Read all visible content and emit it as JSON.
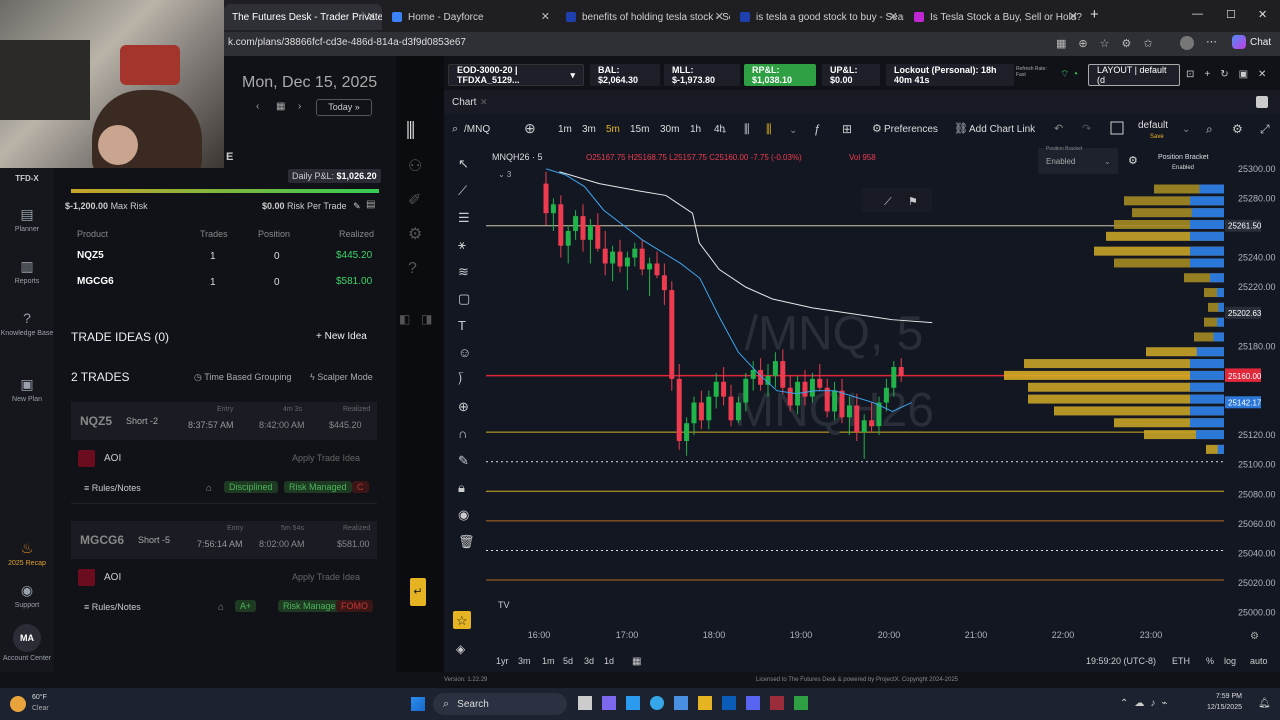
{
  "browser": {
    "tabs": [
      {
        "label": "The Futures Desk - Trader Private",
        "active": true,
        "color": "#2a6bd1"
      },
      {
        "label": "Home - Dayforce",
        "active": false,
        "color": "#3b82f6"
      },
      {
        "label": "benefits of holding tesla stock - Se",
        "active": false,
        "color": "#3b82f6"
      },
      {
        "label": "is tesla a good stock to buy - Sear",
        "active": false,
        "color": "#3b82f6"
      },
      {
        "label": "Is Tesla Stock a Buy, Sell or Hold?",
        "active": false,
        "color": "#c026d3"
      }
    ],
    "url": "k.com/plans/38866fcf-cd3e-486d-814a-d3f9d0853e67",
    "chat_label": "Chat"
  },
  "sidebar": {
    "brand": "TFD-X",
    "items": [
      {
        "label": "Planner",
        "icon": "book-icon"
      },
      {
        "label": "Reports",
        "icon": "bar-chart-icon"
      },
      {
        "label": "Knowledge Base",
        "icon": "question-icon"
      },
      {
        "label": "New Plan",
        "icon": "new-plan-icon"
      },
      {
        "label": "2025 Recap",
        "icon": "flame-icon"
      },
      {
        "label": "Support",
        "icon": "support-icon"
      },
      {
        "label": "Account Center",
        "icon": "avatar-icon"
      }
    ],
    "avatar_initials": "MA"
  },
  "plan": {
    "date": "Mon, Dec 15, 2025",
    "today_label": "Today",
    "letter_e": "E",
    "daily_pnl_label": "Daily P&L:",
    "daily_pnl_value": "$1,026.20",
    "max_risk_value": "$-1,200.00",
    "max_risk_label": "Max Risk",
    "risk_per_trade_value": "$0.00",
    "risk_per_trade_label": "Risk Per Trade",
    "table_headers": [
      "Product",
      "Trades",
      "Position",
      "Realized"
    ],
    "table_rows": [
      {
        "product": "NQZ5",
        "trades": "1",
        "position": "0",
        "realized": "$445.20"
      },
      {
        "product": "MGCG6",
        "trades": "1",
        "position": "0",
        "realized": "$581.00"
      }
    ],
    "trade_ideas_title": "TRADE IDEAS (0)",
    "new_idea_label": "+ New Idea",
    "trades_title": "2 TRADES",
    "time_grouping_label": "Time Based Grouping",
    "scalper_label": "Scalper Mode",
    "trades": [
      {
        "symbol": "NQZ5",
        "side": "Short -2",
        "entry_label": "Entry",
        "entry_time": "8:37:57 AM",
        "duration": "4m 3s",
        "exit_time": "8:42:00 AM",
        "realized_label": "Realized",
        "realized": "$445.20",
        "aoi": "AOI",
        "apply": "Apply Trade Idea",
        "rules": "Rules/Notes",
        "tags": [
          "Disciplined",
          "Risk Managed"
        ]
      },
      {
        "symbol": "MGCG6",
        "side": "Short -5",
        "entry_label": "Entry",
        "entry_time": "7:56:14 AM",
        "duration": "5m 54s",
        "exit_time": "8:02:00 AM",
        "realized_label": "Realized",
        "realized": "$581.00",
        "aoi": "AOI",
        "apply": "Apply Trade Idea",
        "rules": "Rules/Notes",
        "tags": [
          "A+",
          "Risk Managed",
          "FOMO"
        ]
      }
    ]
  },
  "topbar": {
    "account": "EOD-3000-20 | TFDXA_5129...",
    "bal": "BAL: $2,064.30",
    "mll": "MLL: $-1,973.80",
    "rpl": "RP&L: $1,038.10",
    "upl": "UP&L: $0.00",
    "lockout": "Lockout (Personal): 18h 40m 41s",
    "refresh": "Refresh Rate: Fast",
    "layout": "LAYOUT | default (d"
  },
  "chart": {
    "tab_label": "Chart",
    "symbol_search": "/MNQ",
    "timeframes": [
      "1m",
      "3m",
      "5m",
      "15m",
      "30m",
      "1h",
      "4h"
    ],
    "active_timeframe": "5m",
    "preferences_label": "Preferences",
    "add_link_label": "Add Chart Link",
    "default_label": "default",
    "save_label": "Save",
    "legend_symbol": "MNQH26 · 5",
    "ohlc": "O25167.75 H25168.75 L25157.75 C25160.00 -7.75 (-0.03%)",
    "vol": "Vol 958",
    "indicator_count": "3",
    "watermark_line1": "/MNQ, 5",
    "watermark_line2": "MNQH26",
    "bracket_label": "Position Bracket",
    "bracket_value": "Enabled",
    "bracket_title": "Position Bracket",
    "bracket_status": "Enabled",
    "price_axis": [
      "25300.00",
      "25280.00",
      "25240.00",
      "25220.00",
      "25180.00",
      "25120.00",
      "25100.00",
      "25080.00",
      "25060.00",
      "25040.00",
      "25020.00",
      "25000.00"
    ],
    "price_labels": [
      {
        "value": "25261.50",
        "color": "#2a2e39"
      },
      {
        "value": "25202.63",
        "color": "#2a2e39"
      },
      {
        "value": "25161.00",
        "color": "#e0283b"
      },
      {
        "value": "25160.00",
        "color": "#e0283b"
      },
      {
        "value": "25142.17",
        "color": "#2b78d8"
      }
    ],
    "time_axis": [
      "16:00",
      "17:00",
      "18:00",
      "19:00",
      "20:00",
      "21:00",
      "22:00",
      "23:00"
    ],
    "ranges": [
      "1yr",
      "3m",
      "1m",
      "5d",
      "3d",
      "1d"
    ],
    "clock": "19:59:20 (UTC-8)",
    "eth": "ETH",
    "pct": "%",
    "log": "log",
    "auto": "auto"
  },
  "footer": {
    "version": "Version: 1.22.29",
    "license": "Licensed to The Futures Desk & powered by ProjectX. Copyright 2024-2025"
  },
  "taskbar": {
    "weather_temp": "60°F",
    "weather_desc": "Clear",
    "search_label": "Search",
    "time": "7:59 PM",
    "date": "12/15/2025"
  }
}
